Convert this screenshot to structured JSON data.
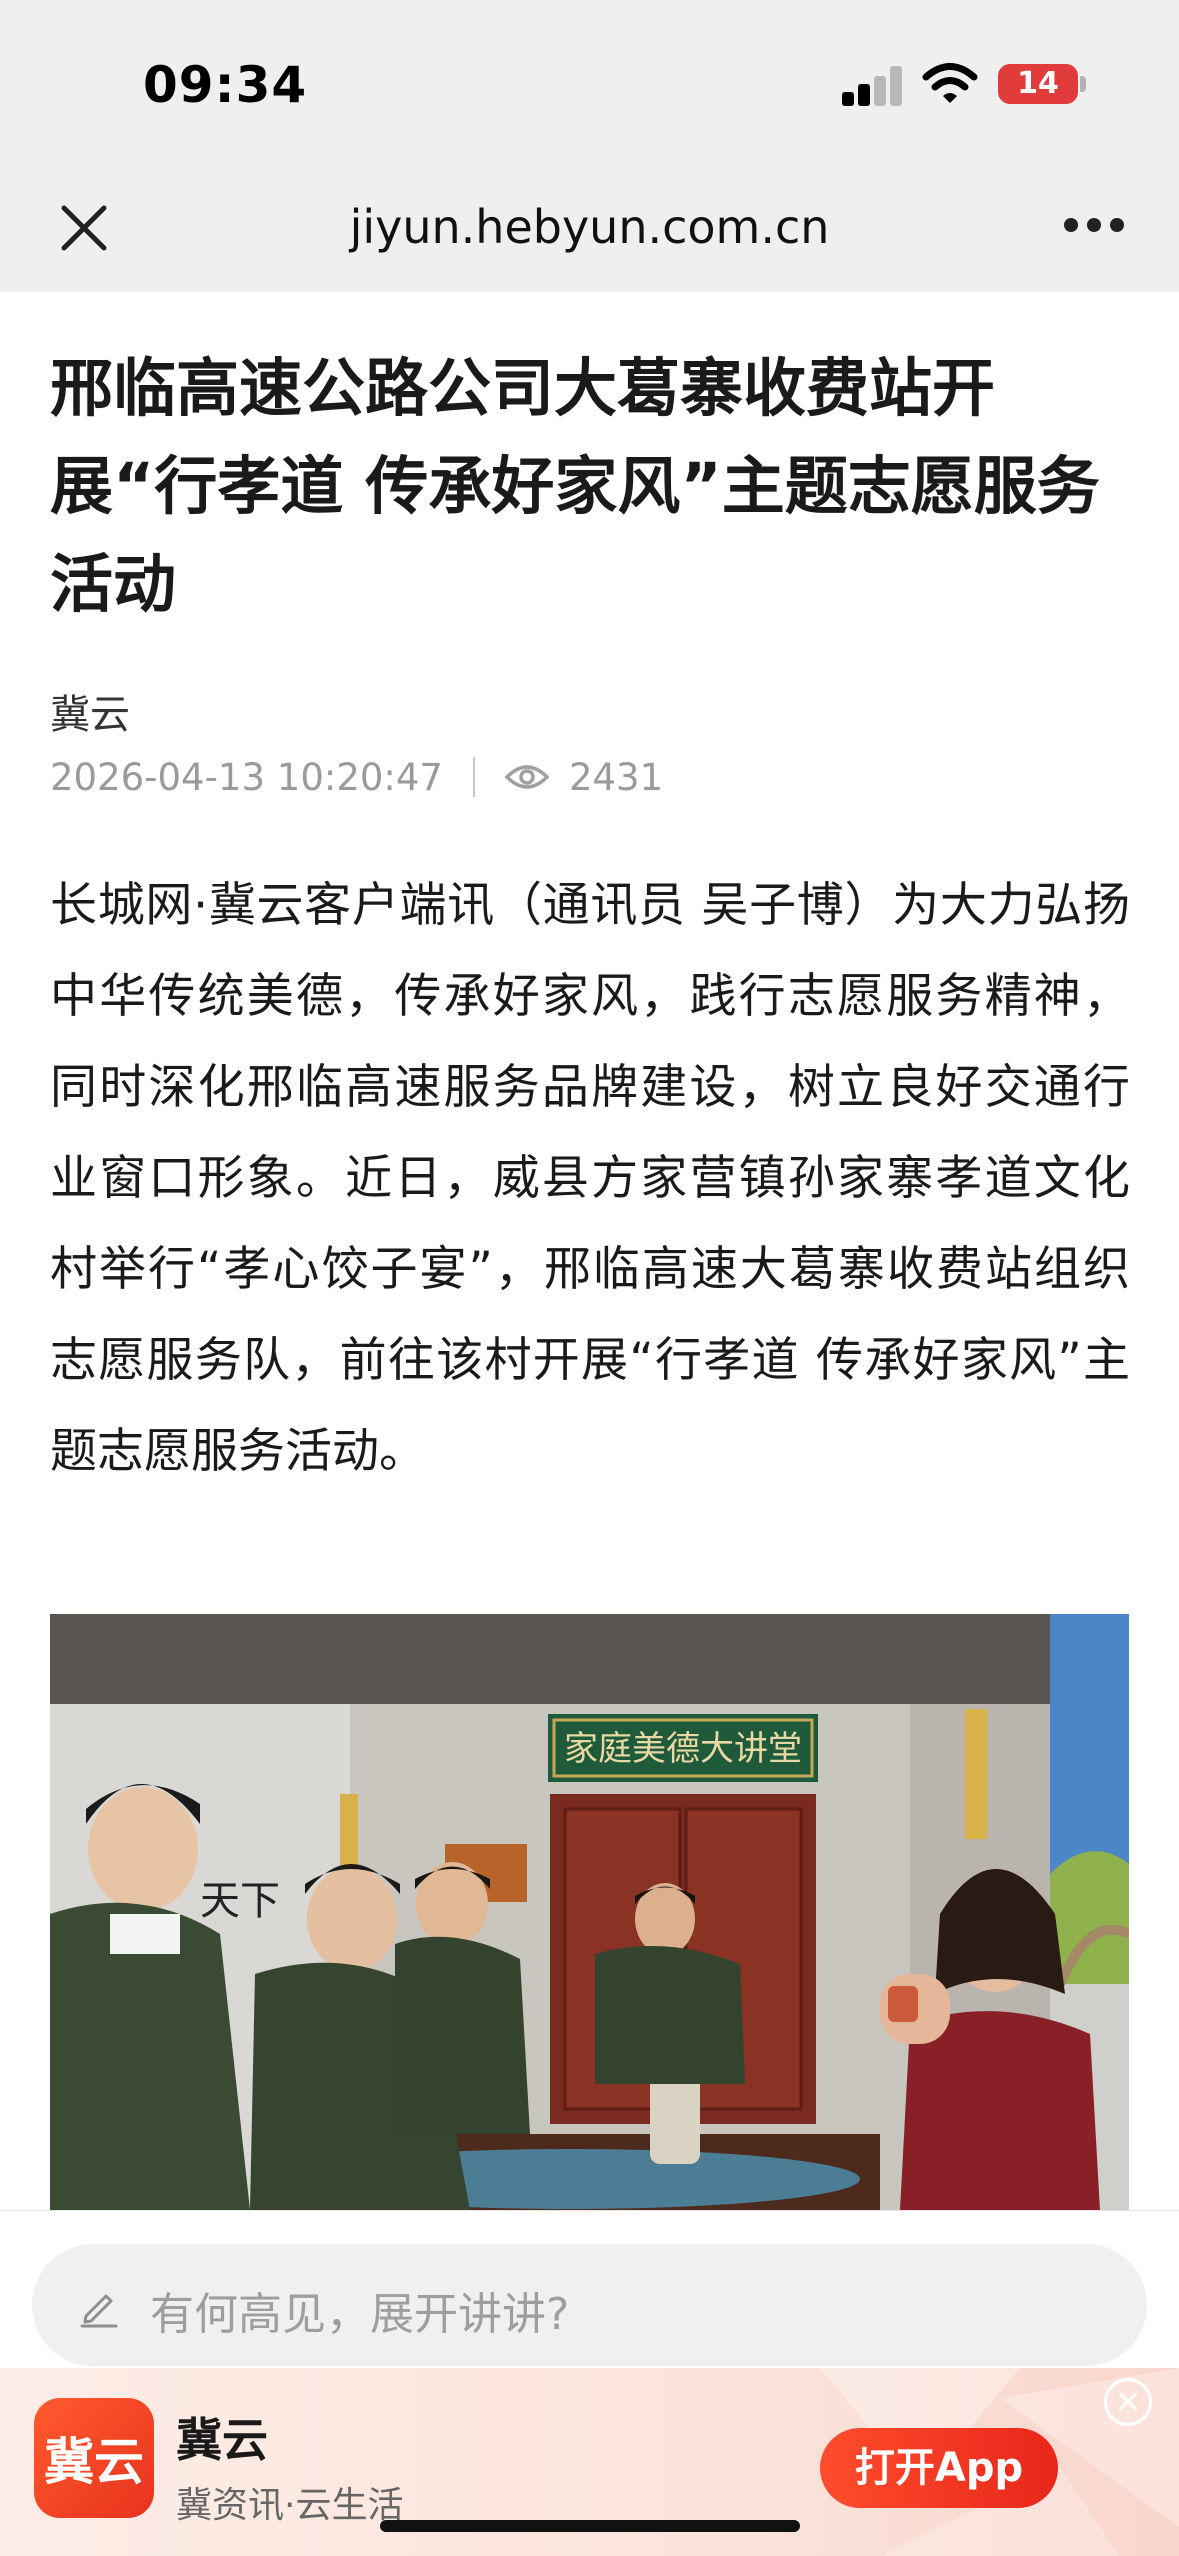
{
  "status_bar": {
    "time": "09:34",
    "battery": "14"
  },
  "browser": {
    "url": "jiyun.hebyun.com.cn"
  },
  "article": {
    "title": "邢临高速公路公司大葛寨收费站开展“行孝道 传承好家风”主题志愿服务活动",
    "source": "冀云",
    "datetime": "2026-04-13 10:20:47",
    "views": "2431",
    "body": "长城网·冀云客户端讯（通讯员 吴子博）为大力弘扬中华传统美德，传承好家风，践行志愿服务精神，同时深化邢临高速服务品牌建设，树立良好交通行业窗口形象。近日，威县方家营镇孙家寨孝道文化村举行“孝心饺子宴”，邢临高速大葛寨收费站组织志愿服务队，前往该村开展“行孝道 传承好家风”主题志愿服务活动。"
  },
  "photo": {
    "plaque_text": "家庭美德大讲堂",
    "calligraphy_text": "天下"
  },
  "comment": {
    "placeholder": "有何高见，展开讲讲?"
  },
  "app_banner": {
    "logo_text": "冀云",
    "name": "冀云",
    "slogan": "冀资讯·云生活",
    "open_label": "打开App"
  },
  "colors": {
    "accent": "#e8331d",
    "header_bg": "#efefef"
  }
}
